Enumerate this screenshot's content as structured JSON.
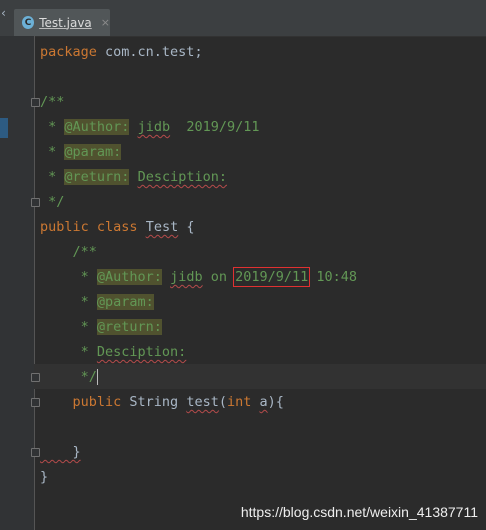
{
  "tab": {
    "icon_letter": "C",
    "label": "Test.java",
    "close_glyph": "×"
  },
  "code": {
    "l1_kw": "package",
    "l1_rest": " com.cn.test;",
    "l3": "/**",
    "l4_prefix": " * ",
    "l4_tag": "@Author:",
    "l4_name": "jidb",
    "l4_date": "  2019/9/11",
    "l5_prefix": " * ",
    "l5_tag": "@param:",
    "l6_prefix": " * ",
    "l6_tag": "@return:",
    "l6_rest": "Desciption:",
    "l7": " */",
    "l8_kw": "public class",
    "l8_name": "Test",
    "l8_rest": " {",
    "l9": "    /**",
    "l10_prefix": "     * ",
    "l10_tag": "@Author:",
    "l10_name": "jidb",
    "l10_on": " on ",
    "l10_date": "2019/9/11",
    "l10_time": " 10:48",
    "l11_prefix": "     * ",
    "l11_tag": "@param:",
    "l12_prefix": "     * ",
    "l12_tag": "@return:",
    "l13_prefix": "     * ",
    "l13_rest": "Desciption:",
    "l14": "     */",
    "l15_kw": "    public ",
    "l15_type": "String ",
    "l15_name": "test",
    "l15_paren": "(",
    "l15_int": "int ",
    "l15_param": "a",
    "l15_close": "){",
    "l17": "    }",
    "l18": "}"
  },
  "watermark": "https://blog.csdn.net/weixin_41387711",
  "colors": {
    "background": "#2b2b2b",
    "keyword": "#cc7832",
    "comment": "#629755",
    "highlight_box": "#e03131"
  }
}
